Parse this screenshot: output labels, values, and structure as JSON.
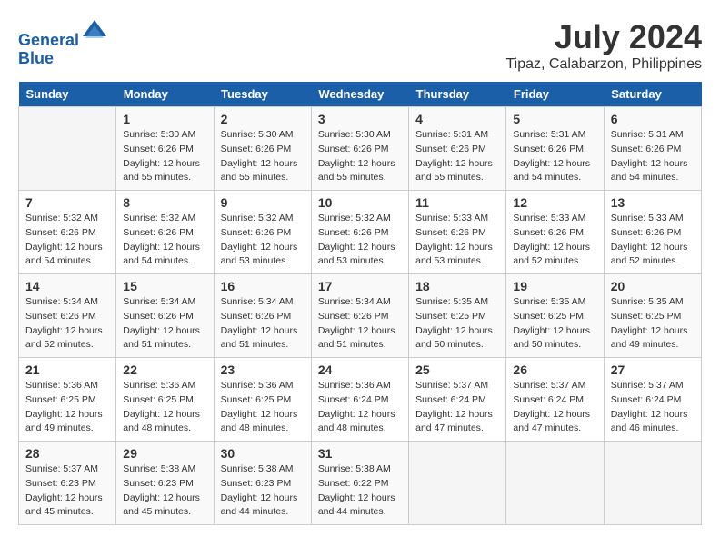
{
  "header": {
    "logo_line1": "General",
    "logo_line2": "Blue",
    "month_year": "July 2024",
    "location": "Tipaz, Calabarzon, Philippines"
  },
  "days_of_week": [
    "Sunday",
    "Monday",
    "Tuesday",
    "Wednesday",
    "Thursday",
    "Friday",
    "Saturday"
  ],
  "weeks": [
    [
      {
        "day": "",
        "info": ""
      },
      {
        "day": "1",
        "info": "Sunrise: 5:30 AM\nSunset: 6:26 PM\nDaylight: 12 hours\nand 55 minutes."
      },
      {
        "day": "2",
        "info": "Sunrise: 5:30 AM\nSunset: 6:26 PM\nDaylight: 12 hours\nand 55 minutes."
      },
      {
        "day": "3",
        "info": "Sunrise: 5:30 AM\nSunset: 6:26 PM\nDaylight: 12 hours\nand 55 minutes."
      },
      {
        "day": "4",
        "info": "Sunrise: 5:31 AM\nSunset: 6:26 PM\nDaylight: 12 hours\nand 55 minutes."
      },
      {
        "day": "5",
        "info": "Sunrise: 5:31 AM\nSunset: 6:26 PM\nDaylight: 12 hours\nand 54 minutes."
      },
      {
        "day": "6",
        "info": "Sunrise: 5:31 AM\nSunset: 6:26 PM\nDaylight: 12 hours\nand 54 minutes."
      }
    ],
    [
      {
        "day": "7",
        "info": "Sunrise: 5:32 AM\nSunset: 6:26 PM\nDaylight: 12 hours\nand 54 minutes."
      },
      {
        "day": "8",
        "info": "Sunrise: 5:32 AM\nSunset: 6:26 PM\nDaylight: 12 hours\nand 54 minutes."
      },
      {
        "day": "9",
        "info": "Sunrise: 5:32 AM\nSunset: 6:26 PM\nDaylight: 12 hours\nand 53 minutes."
      },
      {
        "day": "10",
        "info": "Sunrise: 5:32 AM\nSunset: 6:26 PM\nDaylight: 12 hours\nand 53 minutes."
      },
      {
        "day": "11",
        "info": "Sunrise: 5:33 AM\nSunset: 6:26 PM\nDaylight: 12 hours\nand 53 minutes."
      },
      {
        "day": "12",
        "info": "Sunrise: 5:33 AM\nSunset: 6:26 PM\nDaylight: 12 hours\nand 52 minutes."
      },
      {
        "day": "13",
        "info": "Sunrise: 5:33 AM\nSunset: 6:26 PM\nDaylight: 12 hours\nand 52 minutes."
      }
    ],
    [
      {
        "day": "14",
        "info": "Sunrise: 5:34 AM\nSunset: 6:26 PM\nDaylight: 12 hours\nand 52 minutes."
      },
      {
        "day": "15",
        "info": "Sunrise: 5:34 AM\nSunset: 6:26 PM\nDaylight: 12 hours\nand 51 minutes."
      },
      {
        "day": "16",
        "info": "Sunrise: 5:34 AM\nSunset: 6:26 PM\nDaylight: 12 hours\nand 51 minutes."
      },
      {
        "day": "17",
        "info": "Sunrise: 5:34 AM\nSunset: 6:26 PM\nDaylight: 12 hours\nand 51 minutes."
      },
      {
        "day": "18",
        "info": "Sunrise: 5:35 AM\nSunset: 6:25 PM\nDaylight: 12 hours\nand 50 minutes."
      },
      {
        "day": "19",
        "info": "Sunrise: 5:35 AM\nSunset: 6:25 PM\nDaylight: 12 hours\nand 50 minutes."
      },
      {
        "day": "20",
        "info": "Sunrise: 5:35 AM\nSunset: 6:25 PM\nDaylight: 12 hours\nand 49 minutes."
      }
    ],
    [
      {
        "day": "21",
        "info": "Sunrise: 5:36 AM\nSunset: 6:25 PM\nDaylight: 12 hours\nand 49 minutes."
      },
      {
        "day": "22",
        "info": "Sunrise: 5:36 AM\nSunset: 6:25 PM\nDaylight: 12 hours\nand 48 minutes."
      },
      {
        "day": "23",
        "info": "Sunrise: 5:36 AM\nSunset: 6:25 PM\nDaylight: 12 hours\nand 48 minutes."
      },
      {
        "day": "24",
        "info": "Sunrise: 5:36 AM\nSunset: 6:24 PM\nDaylight: 12 hours\nand 48 minutes."
      },
      {
        "day": "25",
        "info": "Sunrise: 5:37 AM\nSunset: 6:24 PM\nDaylight: 12 hours\nand 47 minutes."
      },
      {
        "day": "26",
        "info": "Sunrise: 5:37 AM\nSunset: 6:24 PM\nDaylight: 12 hours\nand 47 minutes."
      },
      {
        "day": "27",
        "info": "Sunrise: 5:37 AM\nSunset: 6:24 PM\nDaylight: 12 hours\nand 46 minutes."
      }
    ],
    [
      {
        "day": "28",
        "info": "Sunrise: 5:37 AM\nSunset: 6:23 PM\nDaylight: 12 hours\nand 45 minutes."
      },
      {
        "day": "29",
        "info": "Sunrise: 5:38 AM\nSunset: 6:23 PM\nDaylight: 12 hours\nand 45 minutes."
      },
      {
        "day": "30",
        "info": "Sunrise: 5:38 AM\nSunset: 6:23 PM\nDaylight: 12 hours\nand 44 minutes."
      },
      {
        "day": "31",
        "info": "Sunrise: 5:38 AM\nSunset: 6:22 PM\nDaylight: 12 hours\nand 44 minutes."
      },
      {
        "day": "",
        "info": ""
      },
      {
        "day": "",
        "info": ""
      },
      {
        "day": "",
        "info": ""
      }
    ]
  ]
}
